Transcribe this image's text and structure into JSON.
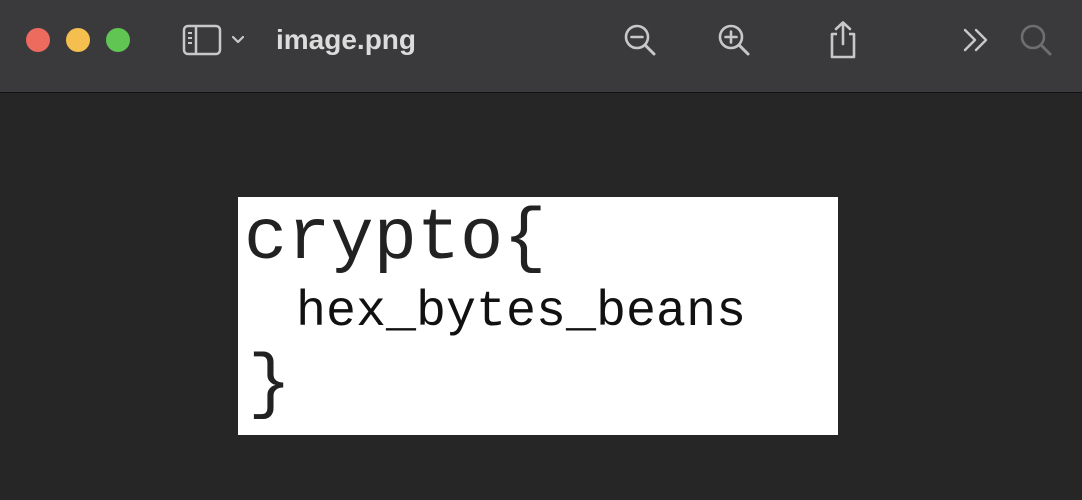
{
  "window": {
    "title": "image.png"
  },
  "toolbar": {
    "sidebar_icon": "sidebar-icon",
    "zoom_out_icon": "zoom-out-icon",
    "zoom_in_icon": "zoom-in-icon",
    "share_icon": "share-icon",
    "more_icon": "chevron-double-right-icon",
    "search_icon": "search-icon"
  },
  "image": {
    "line1": "crypto{",
    "line2": "hex_bytes_beans",
    "line3": "}"
  },
  "colors": {
    "titlebar": "#3a3a3c",
    "content_bg": "#262626",
    "close": "#ed6a5e",
    "minimize": "#f5bf4f",
    "zoom": "#61c554",
    "icon": "#c8c8c8"
  }
}
